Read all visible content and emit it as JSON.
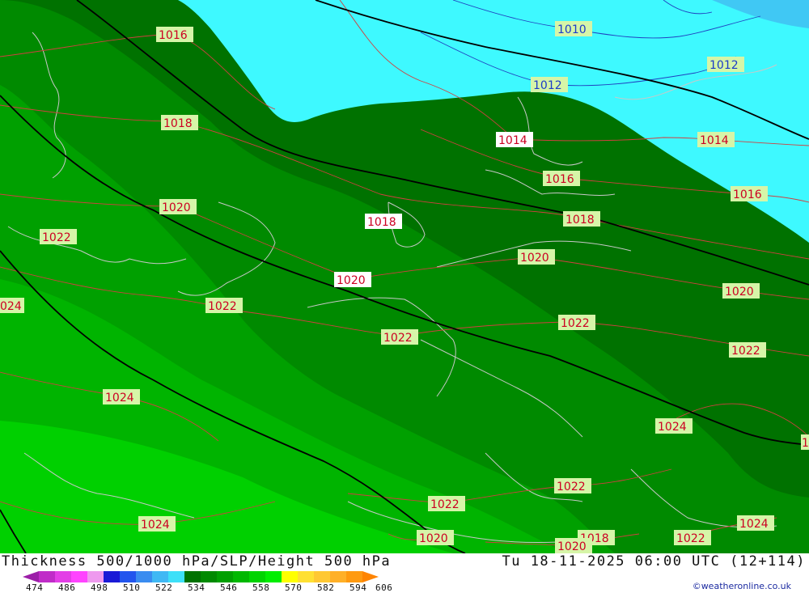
{
  "footer": {
    "title": "Thickness 500/1000 hPa/SLP/Height 500 hPa",
    "datetime": "Tu 18-11-2025 06:00 UTC (12+114)",
    "credit": "©weatheronline.co.uk"
  },
  "legend": {
    "ticks": [
      "474",
      "486",
      "498",
      "510",
      "522",
      "534",
      "546",
      "558",
      "570",
      "582",
      "594",
      "606"
    ],
    "colors": [
      "#9c1ea8",
      "#c02cc8",
      "#e33ee6",
      "#ff44ff",
      "#ee99ee",
      "#1a1ad6",
      "#2255ee",
      "#3a8cf0",
      "#40b8f4",
      "#3de0f8",
      "#007200",
      "#008a00",
      "#00a000",
      "#00b800",
      "#00d400",
      "#00ee00",
      "#ffff00",
      "#ffe033",
      "#ffc833",
      "#ffb028",
      "#ff9a10",
      "#ff8400"
    ]
  },
  "map": {
    "region": "Central & Western Europe",
    "contour_unit": "hPa",
    "isobar_labels": [
      {
        "value": "1016",
        "color": "red"
      },
      {
        "value": "1010",
        "color": "blue"
      },
      {
        "value": "1012",
        "color": "blue"
      },
      {
        "value": "1012",
        "color": "blue"
      },
      {
        "value": "1018",
        "color": "red"
      },
      {
        "value": "1014",
        "color": "red"
      },
      {
        "value": "1014",
        "color": "red"
      },
      {
        "value": "1016",
        "color": "red"
      },
      {
        "value": "1016",
        "color": "red"
      },
      {
        "value": "1020",
        "color": "red"
      },
      {
        "value": "1018",
        "color": "red"
      },
      {
        "value": "1018",
        "color": "red"
      },
      {
        "value": "1022",
        "color": "red"
      },
      {
        "value": "1020",
        "color": "red"
      },
      {
        "value": "1020",
        "color": "red"
      },
      {
        "value": "1020",
        "color": "red"
      },
      {
        "value": "024",
        "color": "red"
      },
      {
        "value": "1022",
        "color": "red"
      },
      {
        "value": "1022",
        "color": "red"
      },
      {
        "value": "1022",
        "color": "red"
      },
      {
        "value": "1022",
        "color": "red"
      },
      {
        "value": "1024",
        "color": "red"
      },
      {
        "value": "1024",
        "color": "red"
      },
      {
        "value": "1",
        "color": "red"
      },
      {
        "value": "1022",
        "color": "red"
      },
      {
        "value": "1022",
        "color": "red"
      },
      {
        "value": "1024",
        "color": "red"
      },
      {
        "value": "1024",
        "color": "red"
      },
      {
        "value": "1020",
        "color": "red"
      },
      {
        "value": "1018",
        "color": "red"
      },
      {
        "value": "1020",
        "color": "red"
      },
      {
        "value": "1022",
        "color": "red"
      }
    ]
  }
}
